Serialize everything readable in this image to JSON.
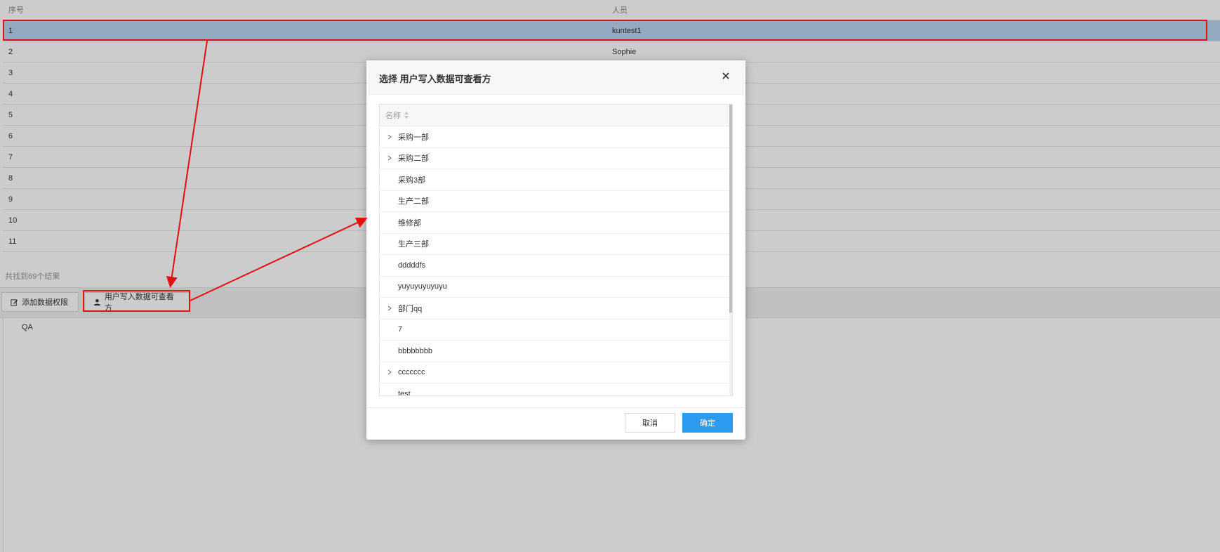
{
  "table": {
    "columns": [
      "序号",
      "人员"
    ],
    "rows": [
      {
        "index": "1",
        "person": "kuntest1",
        "selected": true
      },
      {
        "index": "2",
        "person": "Sophie"
      },
      {
        "index": "3",
        "person": ""
      },
      {
        "index": "4",
        "person": ""
      },
      {
        "index": "5",
        "person": ""
      },
      {
        "index": "6",
        "person": ""
      },
      {
        "index": "7",
        "person": ""
      },
      {
        "index": "8",
        "person": ""
      },
      {
        "index": "9",
        "person": ""
      },
      {
        "index": "10",
        "person": ""
      },
      {
        "index": "11",
        "person": ""
      }
    ],
    "summary": "共找到69个结果"
  },
  "toolbar": {
    "add_permission": "添加数据权限",
    "set_visible": "用户写入数据可查看方"
  },
  "bottom": {
    "item": "QA"
  },
  "dialog": {
    "title": "选择 用户写入数据可查看方",
    "column_header": "名称",
    "items": [
      {
        "label": "采购一部",
        "expandable": true
      },
      {
        "label": "采购二部",
        "expandable": true
      },
      {
        "label": "采购3部",
        "expandable": false
      },
      {
        "label": "生产二部",
        "expandable": false
      },
      {
        "label": "维修部",
        "expandable": false
      },
      {
        "label": "生产三部",
        "expandable": false
      },
      {
        "label": "dddddfs",
        "expandable": false
      },
      {
        "label": "yuyuyuyuyuyu",
        "expandable": false
      },
      {
        "label": "部门qq",
        "expandable": true
      },
      {
        "label": "7",
        "expandable": false
      },
      {
        "label": "bbbbbbbb",
        "expandable": false
      },
      {
        "label": "ccccccc",
        "expandable": true
      },
      {
        "label": "test",
        "expandable": false
      }
    ],
    "cancel": "取消",
    "confirm": "确定"
  },
  "colors": {
    "selected_row": "#b8d4ef",
    "primary": "#2d9cf0",
    "annotation": "#e30f0f"
  }
}
